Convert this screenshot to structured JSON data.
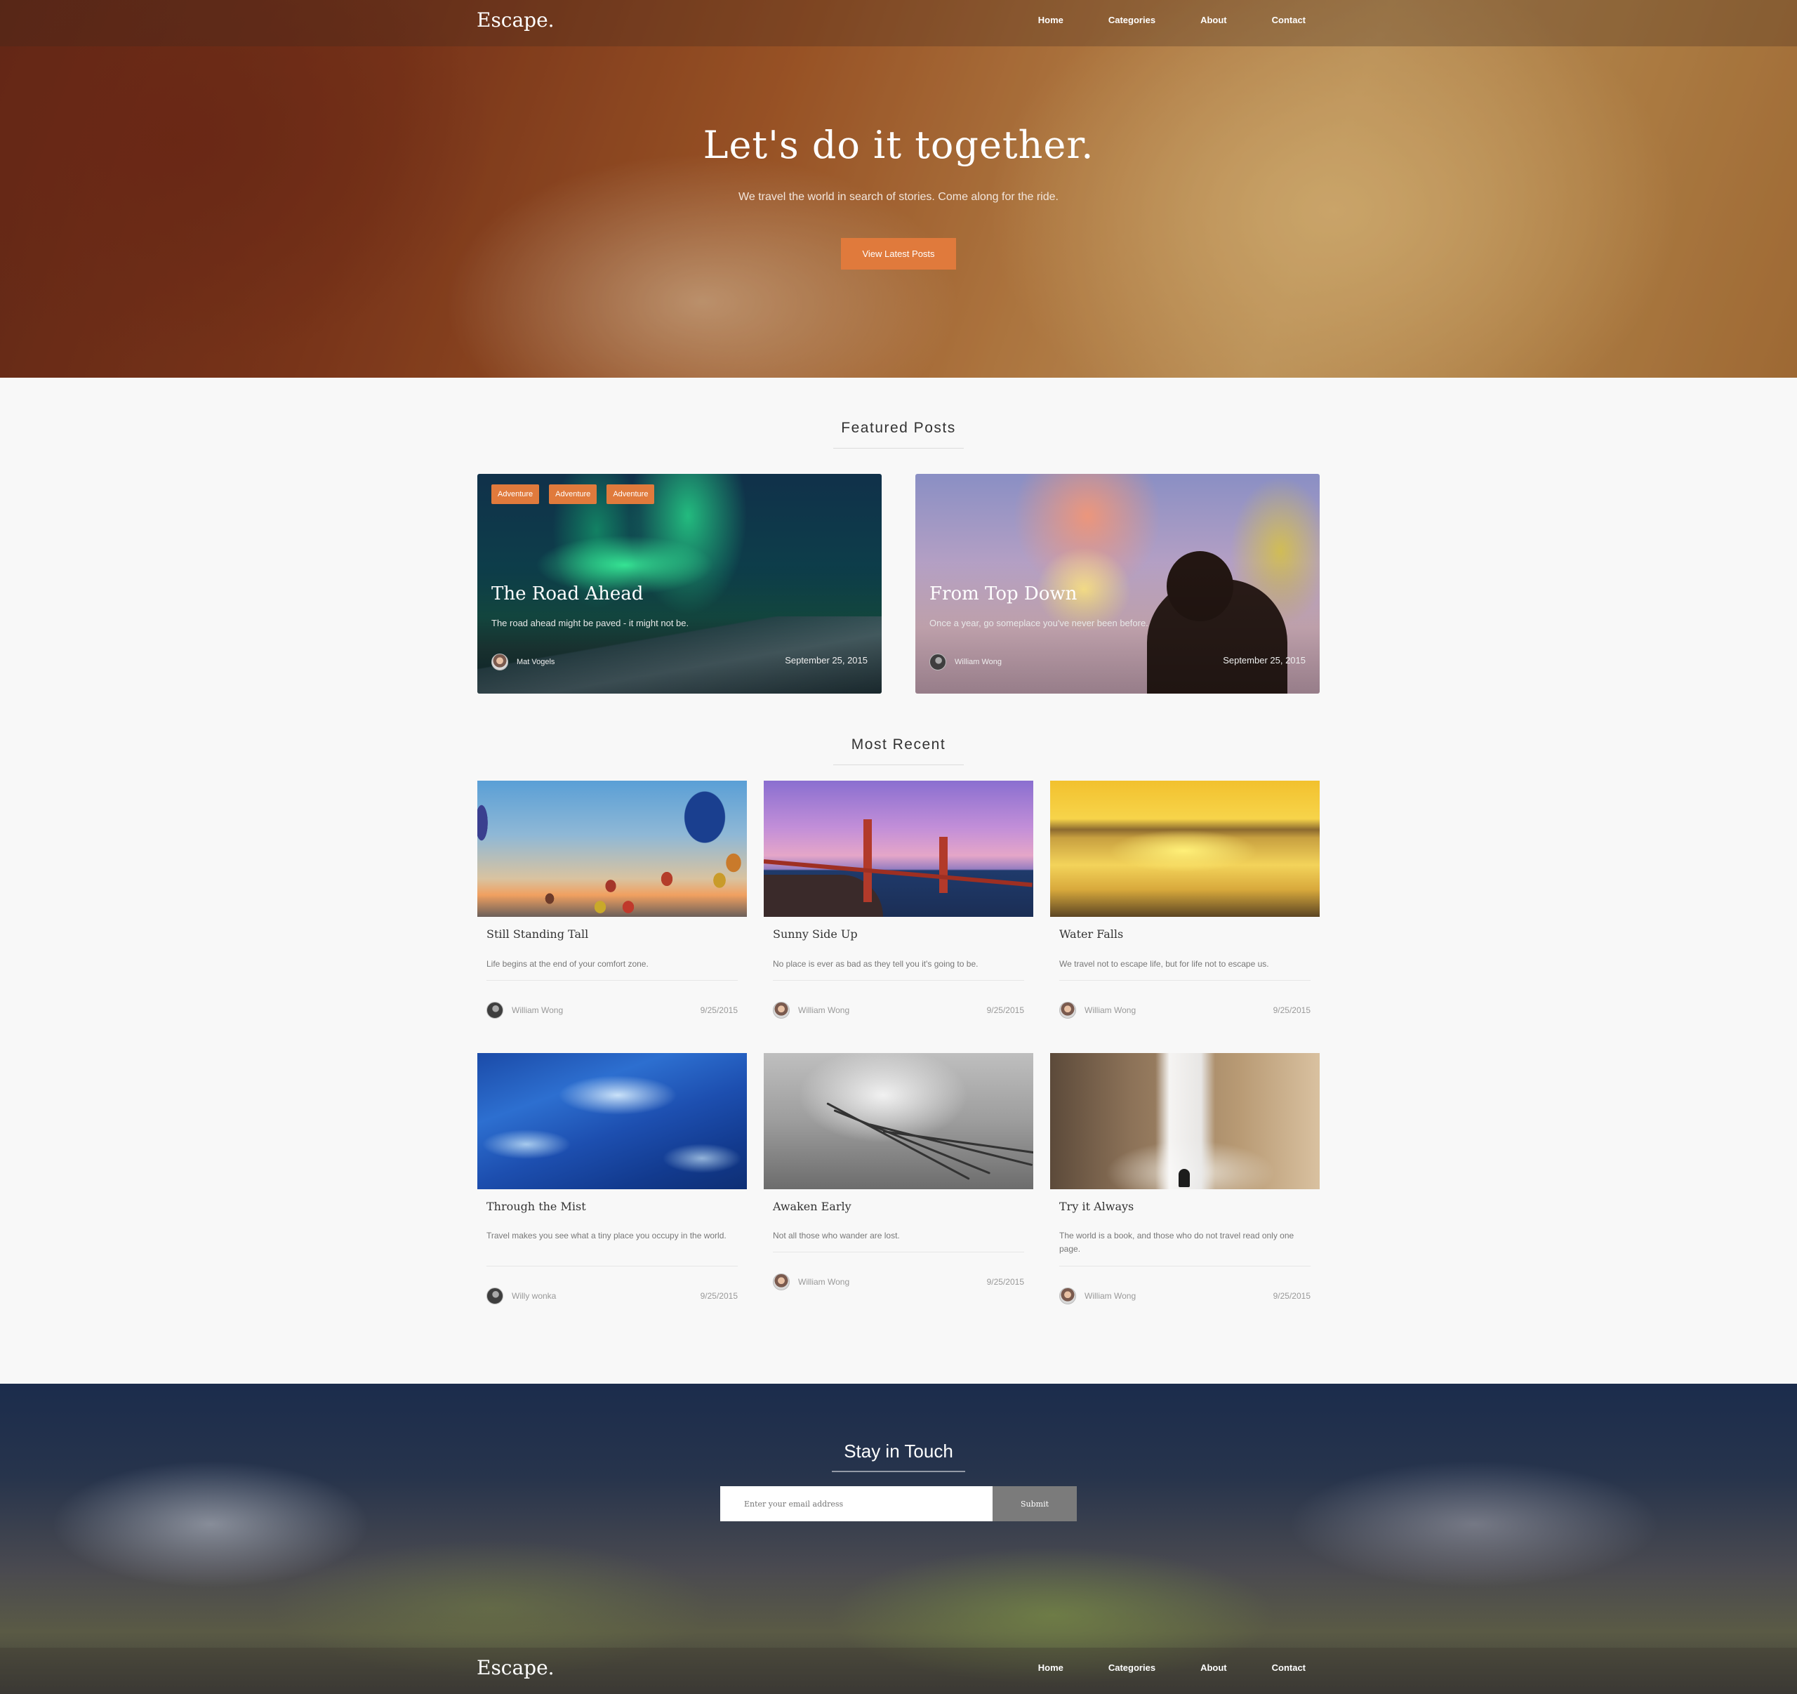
{
  "nav": {
    "brand": "Escape.",
    "links": [
      "Home",
      "Categories",
      "About",
      "Contact"
    ]
  },
  "hero": {
    "title": "Let's do it together.",
    "subtitle": "We travel the world in search of stories. Come along for the ride.",
    "button": "View Latest Posts"
  },
  "featured": {
    "heading": "Featured Posts",
    "posts": [
      {
        "tags": [
          "Adventure",
          "Adventure",
          "Adventure"
        ],
        "title": "The Road Ahead",
        "excerpt": "The road ahead might be paved - it might not be.",
        "author": "Mat Vogels",
        "date": "September 25, 2015"
      },
      {
        "title": "From Top Down",
        "excerpt": "Once a year, go someplace you've never been before.",
        "author": "William Wong",
        "date": "September 25, 2015"
      }
    ]
  },
  "recent": {
    "heading": "Most Recent",
    "posts": [
      {
        "title": "Still Standing Tall",
        "excerpt": "Life begins at the end of your comfort zone.",
        "author": "William Wong",
        "date": "9/25/2015"
      },
      {
        "title": "Sunny Side Up",
        "excerpt": "No place is ever as bad as they tell you it's going to be.",
        "author": "William Wong",
        "date": "9/25/2015"
      },
      {
        "title": "Water Falls",
        "excerpt": "We travel not to escape life, but for life not to escape us.",
        "author": "William Wong",
        "date": "9/25/2015"
      },
      {
        "title": "Through the Mist",
        "excerpt": "Travel makes you see what a tiny place you occupy in the world.",
        "author": "Willy wonka",
        "date": "9/25/2015"
      },
      {
        "title": "Awaken Early",
        "excerpt": "Not all those who wander are lost.",
        "author": "William Wong",
        "date": "9/25/2015"
      },
      {
        "title": "Try it Always",
        "excerpt": "The world is a book, and those who do not travel read only one page.",
        "author": "William Wong",
        "date": "9/25/2015"
      }
    ]
  },
  "newsletter": {
    "heading": "Stay in Touch",
    "placeholder": "Enter your email address",
    "submit": "Submit"
  },
  "footer": {
    "brand": "Escape.",
    "links": [
      "Home",
      "Categories",
      "About",
      "Contact"
    ]
  },
  "colors": {
    "accent": "#e07a3c"
  }
}
